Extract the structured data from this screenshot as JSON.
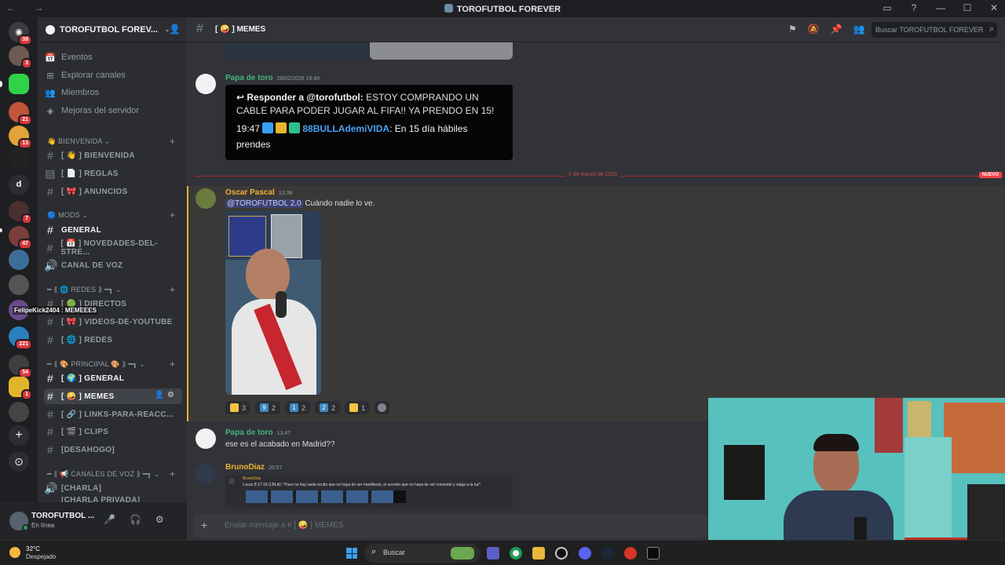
{
  "window": {
    "title": "TOROFUTBOL FOREVER",
    "nav": "← →",
    "controls": [
      "▭",
      "?",
      "—",
      "☐",
      "✕"
    ]
  },
  "guilds": {
    "badges": [
      "39",
      "3",
      "21",
      "13",
      "7",
      "47",
      "221",
      "54",
      "1"
    ],
    "letters": {
      "d": "d"
    },
    "add": "+",
    "discover": "⊙"
  },
  "server": {
    "name": "TOROFUTBOL FOREV...",
    "chevron": "⌄",
    "nav": [
      {
        "icon": "📅",
        "label": "Eventos"
      },
      {
        "icon": "⊞",
        "label": "Explorar canales"
      },
      {
        "icon": "👥",
        "label": "Miembros"
      },
      {
        "icon": "◈",
        "label": "Mejoras del servidor"
      }
    ],
    "categories": [
      {
        "label": "👋 BIENVENIDA ⌄",
        "add": "+"
      },
      {
        "label": "🔵 MODS ⌄",
        "add": "+"
      },
      {
        "label": "━ ⟪ 🌐 REDES ⟫ ━┓ ⌄",
        "add": "+"
      },
      {
        "label": "━ ⟪ 🎨 PRINCIPAL 🎨 ⟫ ━┓ ⌄",
        "add": "+"
      },
      {
        "label": "━ ⟪ 📢 CANALES DE VOZ ⟫ ━┓ ⌄",
        "add": "+"
      }
    ],
    "channels": {
      "bienvenida": "[ 👋 ] BIENVENIDA",
      "reglas": "[ 📄 ] REGLAS",
      "anuncios": "[ 🎀 ] ANUNCIOS",
      "general_mods": "GENERAL",
      "novedades": "[ 📅 ] NOVEDADES-DEL-STRE...",
      "canal_voz": "CANAL DE VOZ",
      "directos": "[ 🟢 ] DIRECTOS",
      "videos": "[ 🎀 ] VIDEOS-DE-YOUTUBE",
      "redes": "[ 🌐 ] REDES",
      "general": "[ 🌍 ] GENERAL",
      "memes": "[ 🤪 ] MEMES",
      "links": "[ 🔗 ] LINKS-PARA-REACC...",
      "clips": "[ 🎬 ] CLIPS",
      "desahogo": "[DESAHOGO]",
      "charla": "[CHARLA]",
      "charla_privada": "[CHARLA PRIVADA]"
    },
    "memes_actions": "👤⚙",
    "voice_tooltip": "FelipeKick2404 : MEMEEES"
  },
  "user": {
    "name": "TOROFUTBOL ...",
    "status": "En línea",
    "controls": [
      "🎤",
      "⌄",
      "🎧",
      "⌄",
      "⚙"
    ]
  },
  "channel": {
    "hash": "#",
    "name": "[ 🤪 ] MEMES",
    "tools": [
      "⚑",
      "🔕",
      "📌",
      "👥"
    ],
    "search_placeholder": "Buscar TOROFUTBOL FOREVER",
    "search_icon": "⌕"
  },
  "messages": [
    {
      "author": "Papa de toro",
      "author_color": "#43b581",
      "timestamp": "26/02/2026 19:49",
      "reply_prefix": "Responder a @torofutbol:",
      "reply_text": " ESTOY COMPRANDO UN CABLE PARA PODER JUGAR AL FIFA!! YA PRENDO EN 15!",
      "line2_time": "19:47",
      "line2_user": "88BULLAdemiVIDA",
      "line2_text": ": En 15 día hábiles prendes"
    },
    {
      "author": "Oscar Pascal",
      "author_color": "#f0b232",
      "timestamp": "13:38",
      "mention": "@TOROFUTBOL 2.0",
      "text": " Cuándo nadie lo ve."
    },
    {
      "author": "Papa de toro",
      "author_color": "#43b581",
      "timestamp": "13:47",
      "text": "ese es el acabado en Madrid??"
    },
    {
      "author": "BrunoDiaz",
      "author_color": "#f0b232",
      "timestamp": "20:57",
      "embed_author": "BrunoDiaz",
      "embed_text": "Lucas 8:17-18 (LBLA): \"Pues no hay nada oculto que no haya de ser manifiesto, ni secreto que no haya de ser conocido y salga a la luz\"."
    }
  ],
  "divider": {
    "date": "2 de marzo de 2026",
    "badge": "NUEVO"
  },
  "reactions": [
    {
      "emoji": "😂",
      "count": "3",
      "color": "#f6c343"
    },
    {
      "emoji": "9",
      "count": "2",
      "color": "#3b88c3"
    },
    {
      "emoji": "1",
      "count": "2",
      "color": "#3b88c3"
    },
    {
      "emoji": "2",
      "count": "2",
      "color": "#3b88c3"
    },
    {
      "emoji": "🤣",
      "count": "1",
      "color": "#f6c343"
    }
  ],
  "composer": {
    "plus": "+",
    "placeholder": "Enviar mensaje a # [ 🤪 ] MEMES"
  },
  "taskbar": {
    "temp": "32°C",
    "weather": "Despejado",
    "search": "Buscar",
    "search_icon": "⌕"
  }
}
